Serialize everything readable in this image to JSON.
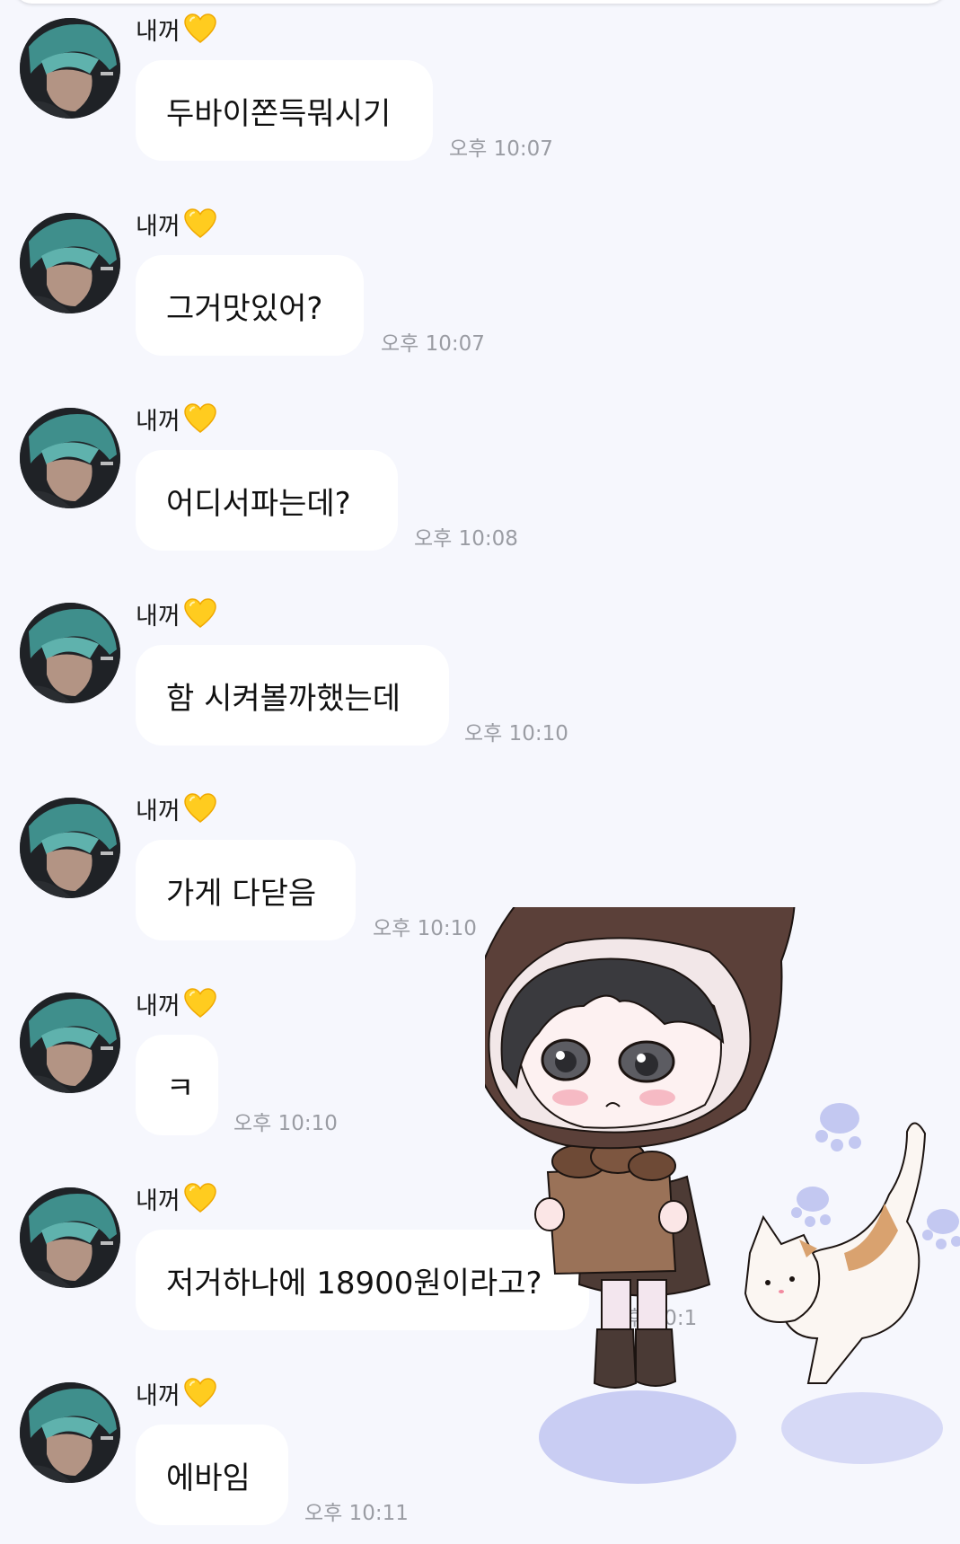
{
  "sender_name": "내꺼",
  "messages": [
    {
      "text": "두바이쫀득뭐시기",
      "time": "오후 10:07"
    },
    {
      "text": "그거맛있어?",
      "time": "오후 10:07"
    },
    {
      "text": "어디서파는데?",
      "time": "오후 10:08"
    },
    {
      "text": "함 시켜볼까했는데",
      "time": "오후 10:10"
    },
    {
      "text": "가게 다닫음",
      "time": "오후 10:10"
    },
    {
      "text": "ㅋ",
      "time": "오후 10:10"
    },
    {
      "text": "저거하나에 18900원이라고?",
      "time": "오후 10:1"
    },
    {
      "text": "에바임",
      "time": "오후 10:11"
    }
  ],
  "icons": {
    "heart": "yellow-heart-icon",
    "avatar": "profile-photo",
    "sticker": "chibi-character-with-cat-sticker"
  },
  "colors": {
    "background": "#f6f7fd",
    "bubble": "#ffffff",
    "heart": "#ffcc1f",
    "timestamp": "#9a9ca3"
  }
}
